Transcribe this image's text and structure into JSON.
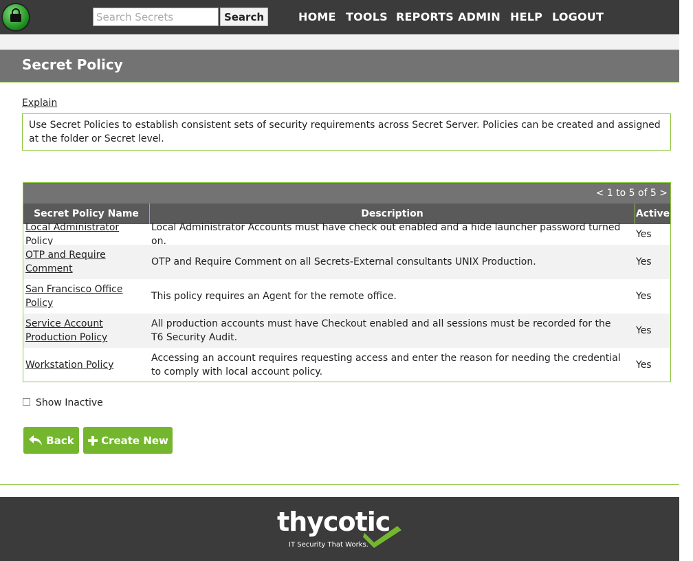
{
  "header": {
    "search": {
      "placeholder": "Search Secrets",
      "value": "",
      "button_label": "Search"
    },
    "nav": [
      "HOME",
      "TOOLS",
      "REPORTS",
      "ADMIN",
      "HELP",
      "LOGOUT"
    ]
  },
  "page": {
    "title": "Secret Policy",
    "explain_link": "Explain",
    "explain_text": "Use Secret Policies to establish consistent sets of security requirements across Secret Server. Policies can be created and assigned at the folder or Secret level."
  },
  "grid": {
    "pager": "< 1 to 5 of 5 >",
    "columns": [
      "Secret Policy Name",
      "Description",
      "Active"
    ],
    "rows": [
      {
        "name": "Local Administrator Policy",
        "description": "Local Administrator Accounts must have check out enabled and a hide launcher password turned on.",
        "active": "Yes"
      },
      {
        "name": "OTP and Require Comment",
        "description": "OTP and Require Comment on all Secrets-External consultants UNIX Production.",
        "active": "Yes"
      },
      {
        "name": "San Francisco Office Policy",
        "description": "This policy requires an Agent for the remote office.",
        "active": "Yes"
      },
      {
        "name": "Service Account Production Policy",
        "description": "All production accounts must have Checkout enabled and all sessions must be recorded for the T6 Security Audit.",
        "active": "Yes"
      },
      {
        "name": "Workstation Policy",
        "description": "Accessing an account requires requesting access and enter the reason for needing the credential to comply with local account policy.",
        "active": "Yes"
      }
    ]
  },
  "show_inactive": {
    "label": "Show Inactive",
    "checked": false
  },
  "buttons": {
    "back": "Back",
    "create_new": "Create New"
  },
  "footer": {
    "brand": "thycotic",
    "tagline": "IT Security That Works."
  },
  "colors": {
    "accent": "#8dc63f",
    "button": "#74b72e",
    "dark_bar": "#3b3b3b",
    "title_bar": "#737373",
    "header_row": "#5a5a5a"
  },
  "icons": {
    "logo": "lock-icon",
    "back": "back-arrow-icon",
    "create": "plus-icon",
    "footer": "checkmark-icon"
  }
}
